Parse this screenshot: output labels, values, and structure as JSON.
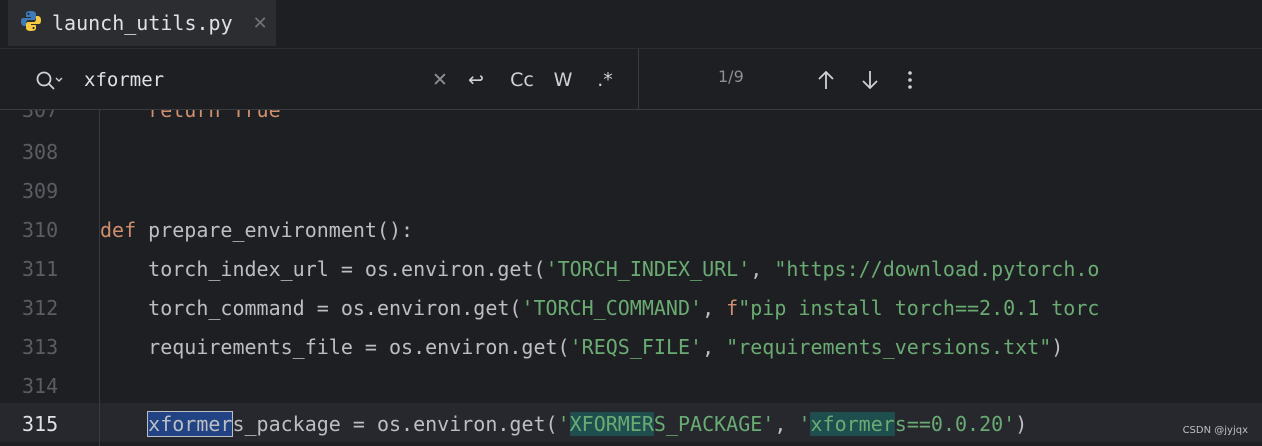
{
  "tab": {
    "filename": "launch_utils.py",
    "icon": "python-icon"
  },
  "search": {
    "query": "xformer",
    "counter": "1/9",
    "buttons": {
      "newline": "↩",
      "match_case": "Cc",
      "whole_word": "W",
      "regex": ".*"
    }
  },
  "editor": {
    "lines": [
      {
        "num": "307",
        "text": "    return True"
      },
      {
        "num": "308",
        "text": ""
      },
      {
        "num": "309",
        "text": ""
      },
      {
        "num": "310",
        "text": "def prepare_environment():"
      },
      {
        "num": "311",
        "text": "    torch_index_url = os.environ.get('TORCH_INDEX_URL', \"https://download.pytorch.o"
      },
      {
        "num": "312",
        "text": "    torch_command = os.environ.get('TORCH_COMMAND', f\"pip install torch==2.0.1 torc"
      },
      {
        "num": "313",
        "text": "    requirements_file = os.environ.get('REQS_FILE', \"requirements_versions.txt\")"
      },
      {
        "num": "314",
        "text": ""
      },
      {
        "num": "315",
        "text": "    xformers_package = os.environ.get('XFORMERS_PACKAGE', 'xformers==0.0.20')"
      }
    ]
  },
  "watermark": "CSDN @jyjqx",
  "colors": {
    "background": "#1e1f22",
    "keyword": "#cf8e6d",
    "string": "#6aab73",
    "active_match": "#214283",
    "match": "#1f4e4e"
  }
}
